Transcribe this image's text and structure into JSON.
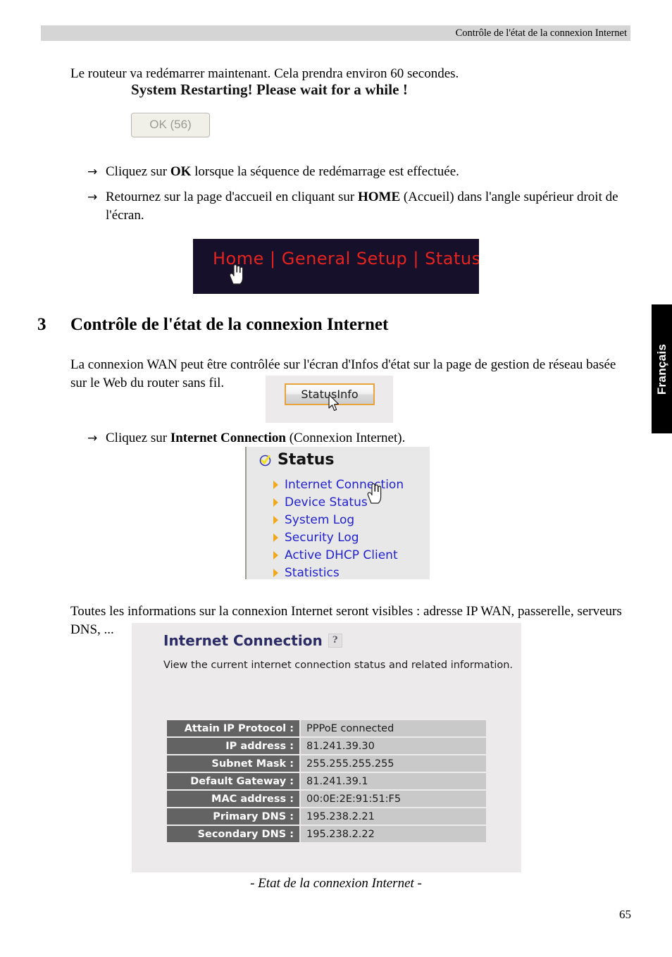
{
  "header": {
    "running_title": "Contrôle de l'état de la connexion Internet"
  },
  "intro": {
    "text": "Le routeur va redémarrer maintenant. Cela prendra environ 60 secondes."
  },
  "restart_figure": {
    "title": "System Restarting! Please wait for a while !",
    "ok_button": "OK (56)"
  },
  "bullets": {
    "arrow_glyph": "→",
    "ok": {
      "prefix": "Cliquez sur ",
      "bold": "OK",
      "suffix": " lorsque la séquence de redémarrage est effectuée."
    },
    "home": {
      "prefix": "Retournez sur la page d'accueil en cliquant sur ",
      "bold": "HOME",
      "suffix": " (Accueil) dans l'angle supérieur droit de l'écran."
    },
    "internet_connection": {
      "prefix": "Cliquez sur ",
      "bold": "Internet Connection",
      "suffix": " (Connexion Internet)."
    }
  },
  "navbar_figure": {
    "text": "Home | General Setup | Status | Tool |",
    "text_color": "#e5231f",
    "background_color": "#16102b",
    "cursor": "hand-cursor"
  },
  "section": {
    "number": "3",
    "title": "Contrôle de l'état de la connexion Internet",
    "paragraph": "La connexion WAN peut être contrôlée sur l'écran d'Infos d'état sur la page de gestion de réseau basée sur le Web du router sans fil."
  },
  "statusinfo_figure": {
    "button_label": "StatusInfo",
    "border_color": "#e8a33d",
    "cursor": "arrow-cursor"
  },
  "status_panel": {
    "title": "Status",
    "title_icon": "check-circle-icon",
    "items": [
      {
        "label": "Internet Connection"
      },
      {
        "label": "Device Status"
      },
      {
        "label": "System Log"
      },
      {
        "label": "Security Log"
      },
      {
        "label": "Active DHCP Client"
      },
      {
        "label": "Statistics"
      }
    ],
    "link_color": "#2222cc",
    "bullet_color": "#f0a81e",
    "cursor": "hand-cursor"
  },
  "paragraph_all_info": "Toutes les informations sur la connexion Internet seront visibles : adresse IP WAN, passerelle, serveurs DNS, ...",
  "internet_connection_panel": {
    "title": "Internet Connection",
    "help_icon": "help-icon",
    "description": "View the current internet connection status and related information.",
    "rows": [
      {
        "label": "Attain IP Protocol :",
        "value": "PPPoE connected"
      },
      {
        "label": "IP address :",
        "value": "81.241.39.30"
      },
      {
        "label": "Subnet Mask :",
        "value": "255.255.255.255"
      },
      {
        "label": "Default Gateway :",
        "value": "81.241.39.1"
      },
      {
        "label": "MAC address :",
        "value": "00:0E:2E:91:51:F5"
      },
      {
        "label": "Primary DNS :",
        "value": "195.238.2.21"
      },
      {
        "label": "Secondary DNS :",
        "value": "195.238.2.22"
      }
    ],
    "label_bg": "#636363",
    "value_bg": "#c9c9c9"
  },
  "figure_caption": "- Etat de la connexion Internet -",
  "side_tab": {
    "label": "Français"
  },
  "page_number": "65"
}
